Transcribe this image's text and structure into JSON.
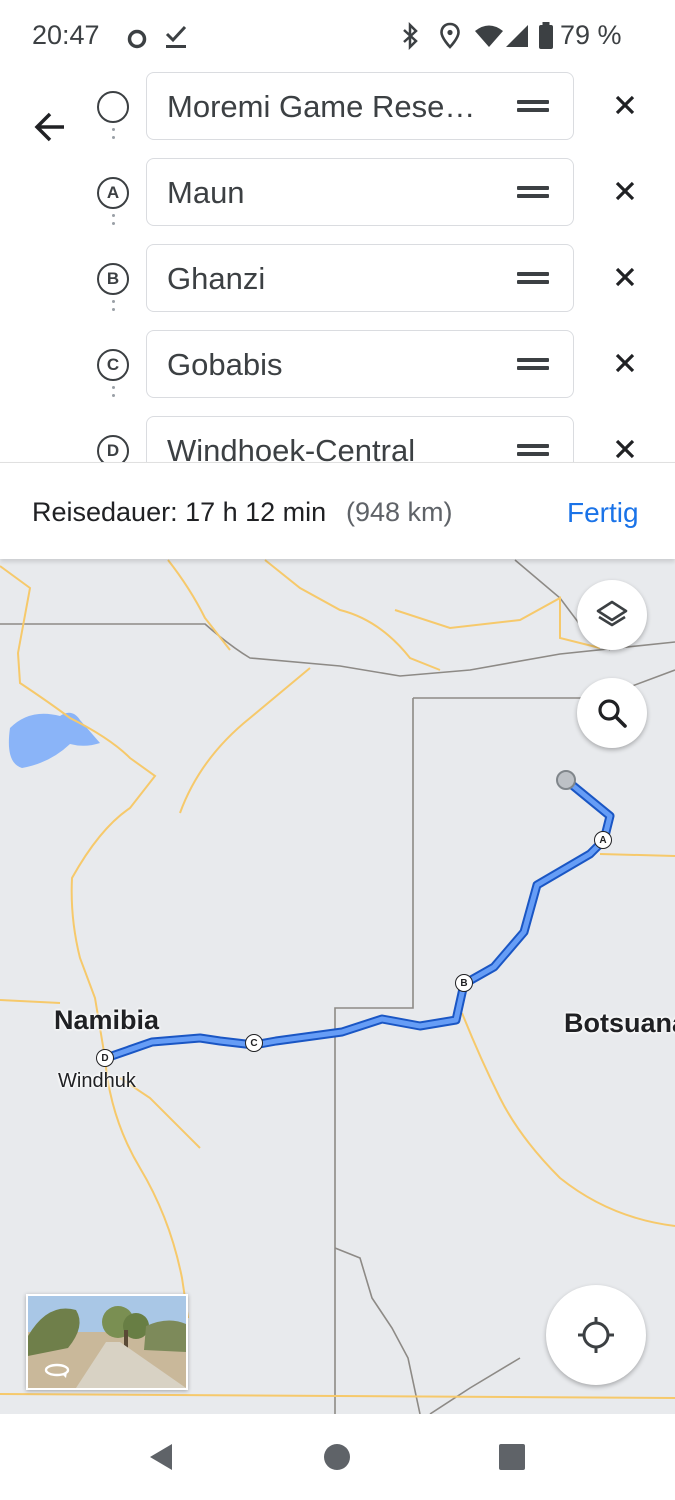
{
  "status_bar": {
    "time": "20:47",
    "battery": "79 %",
    "icons": [
      "sync-circle-icon",
      "task-check-icon",
      "bluetooth-icon",
      "location-icon",
      "wifi-icon",
      "cellular-signal-icon",
      "battery-icon"
    ]
  },
  "waypoints": [
    {
      "marker": "",
      "label": "Moremi Game Rese…"
    },
    {
      "marker": "A",
      "label": "Maun"
    },
    {
      "marker": "B",
      "label": "Ghanzi"
    },
    {
      "marker": "C",
      "label": "Gobabis"
    },
    {
      "marker": "D",
      "label": "Windhoek-Central"
    }
  ],
  "summary": {
    "duration": "Reisedauer: 17 h 12 min",
    "distance": "(948 km)",
    "done_label": "Fertig"
  },
  "map": {
    "labels": {
      "country_namibia": "Namibia",
      "country_botswana": "Botsuana",
      "city_windhoek": "Windhuk"
    },
    "route_stops": [
      "A",
      "B",
      "C",
      "D"
    ],
    "colors": {
      "route": "#4285f4",
      "route_outline": "#1a56c4",
      "road": "#f6c96b",
      "border": "#8d8a86",
      "water": "#8ab4f8",
      "land": "#e8eaed"
    }
  }
}
